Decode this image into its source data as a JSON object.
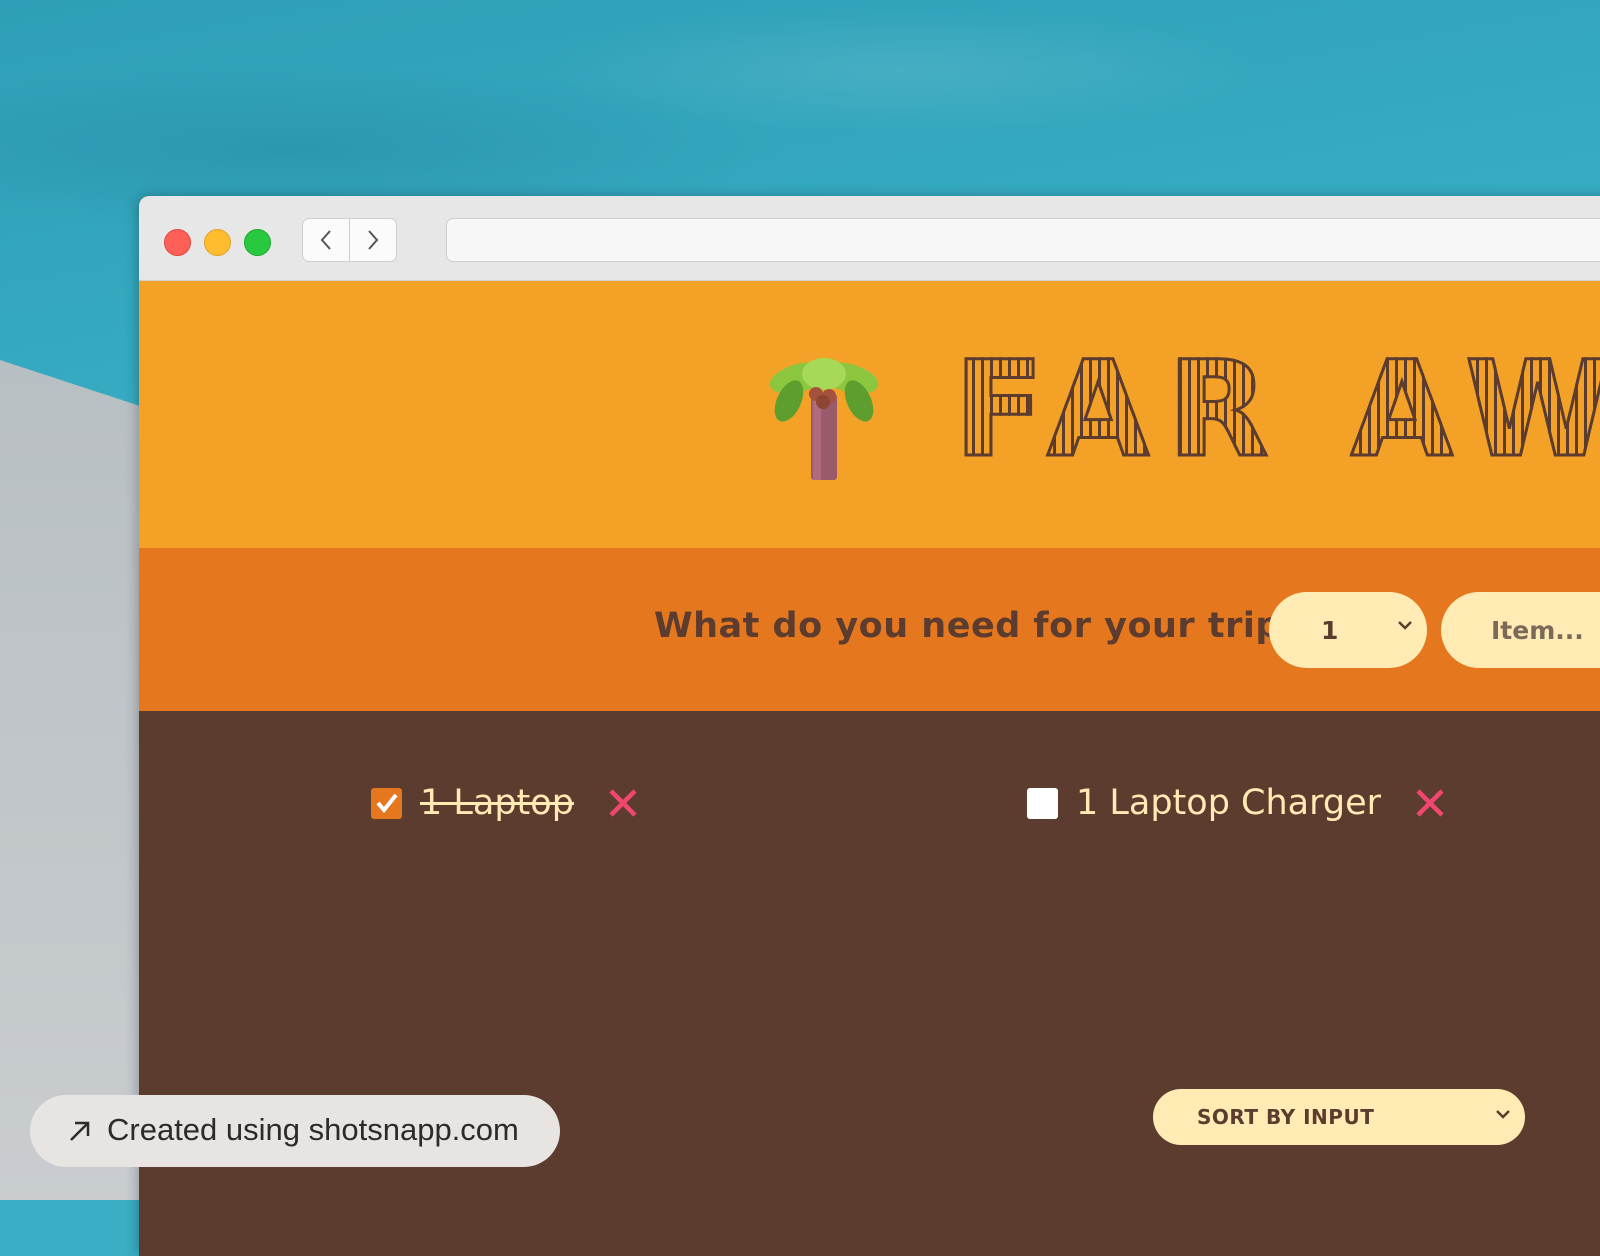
{
  "app": {
    "title": "FAR AWAY",
    "logo_icon": "palm-tree-icon"
  },
  "form": {
    "prompt": "What do you need for your trip",
    "quantity_value": "1",
    "item_placeholder": "Item..."
  },
  "items": [
    {
      "label": "1 Laptop",
      "packed": true
    },
    {
      "label": "1 Laptop Charger",
      "packed": false
    }
  ],
  "sort": {
    "selected": "SORT BY INPUT"
  },
  "badge": {
    "text": "Created using shotsnapp.com"
  },
  "colors": {
    "header": "#f4a227",
    "formbar": "#e5771e",
    "list_bg": "#5b3c2e",
    "cream": "#ffebb3",
    "delete": "#ef476f"
  }
}
